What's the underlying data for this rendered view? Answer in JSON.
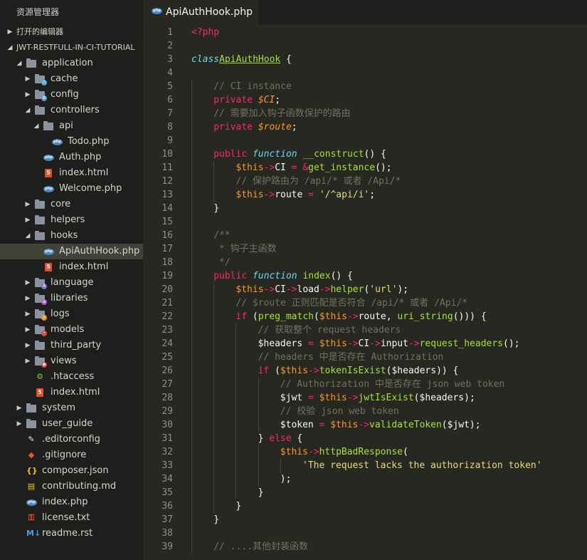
{
  "explorer": {
    "title": "资源管理器",
    "open_editors_label": "打开的编辑器",
    "project_label": "JWT-RESTFULL-IN-CI-TUTORIAL",
    "tree": [
      {
        "label": "application",
        "type": "folder",
        "icon": "folder-icon",
        "indent": 0,
        "chevron": "expanded"
      },
      {
        "label": "cache",
        "type": "folder",
        "icon": "folder-cache-icon",
        "indent": 1,
        "chevron": "collapsed"
      },
      {
        "label": "config",
        "type": "folder",
        "icon": "folder-config-icon",
        "indent": 1,
        "chevron": "collapsed"
      },
      {
        "label": "controllers",
        "type": "folder",
        "icon": "folder-icon",
        "indent": 1,
        "chevron": "expanded"
      },
      {
        "label": "api",
        "type": "folder",
        "icon": "folder-icon",
        "indent": 2,
        "chevron": "expanded"
      },
      {
        "label": "Todo.php",
        "type": "file",
        "icon": "php-icon",
        "indent": 3
      },
      {
        "label": "Auth.php",
        "type": "file",
        "icon": "php-icon",
        "indent": 2
      },
      {
        "label": "index.html",
        "type": "file",
        "icon": "html5-icon",
        "indent": 2
      },
      {
        "label": "Welcome.php",
        "type": "file",
        "icon": "php-icon",
        "indent": 2
      },
      {
        "label": "core",
        "type": "folder",
        "icon": "folder-icon",
        "indent": 1,
        "chevron": "collapsed"
      },
      {
        "label": "helpers",
        "type": "folder",
        "icon": "folder-icon",
        "indent": 1,
        "chevron": "collapsed"
      },
      {
        "label": "hooks",
        "type": "folder",
        "icon": "folder-icon",
        "indent": 1,
        "chevron": "expanded"
      },
      {
        "label": "ApiAuthHook.php",
        "type": "file",
        "icon": "php-icon",
        "indent": 2,
        "selected": true
      },
      {
        "label": "index.html",
        "type": "file",
        "icon": "html5-icon",
        "indent": 2
      },
      {
        "label": "language",
        "type": "folder",
        "icon": "folder-language-icon",
        "indent": 1,
        "chevron": "collapsed"
      },
      {
        "label": "libraries",
        "type": "folder",
        "icon": "folder-libraries-icon",
        "indent": 1,
        "chevron": "collapsed"
      },
      {
        "label": "logs",
        "type": "folder",
        "icon": "folder-logs-icon",
        "indent": 1,
        "chevron": "collapsed"
      },
      {
        "label": "models",
        "type": "folder",
        "icon": "folder-models-icon",
        "indent": 1,
        "chevron": "collapsed"
      },
      {
        "label": "third_party",
        "type": "folder",
        "icon": "folder-icon",
        "indent": 1,
        "chevron": "collapsed"
      },
      {
        "label": "views",
        "type": "folder",
        "icon": "folder-views-icon",
        "indent": 1,
        "chevron": "collapsed"
      },
      {
        "label": ".htaccess",
        "type": "file",
        "icon": "htaccess-icon",
        "indent": 1
      },
      {
        "label": "index.html",
        "type": "file",
        "icon": "html5-icon",
        "indent": 1
      },
      {
        "label": "system",
        "type": "folder",
        "icon": "folder-icon",
        "indent": 0,
        "chevron": "collapsed"
      },
      {
        "label": "user_guide",
        "type": "folder",
        "icon": "folder-icon",
        "indent": 0,
        "chevron": "collapsed"
      },
      {
        "label": ".editorconfig",
        "type": "file",
        "icon": "editorconfig-icon",
        "indent": 0
      },
      {
        "label": ".gitignore",
        "type": "file",
        "icon": "git-icon",
        "indent": 0
      },
      {
        "label": "composer.json",
        "type": "file",
        "icon": "json-icon",
        "indent": 0
      },
      {
        "label": "contributing.md",
        "type": "file",
        "icon": "markdown-icon",
        "indent": 0
      },
      {
        "label": "index.php",
        "type": "file",
        "icon": "php-icon",
        "indent": 0
      },
      {
        "label": "license.txt",
        "type": "file",
        "icon": "license-icon",
        "indent": 0
      },
      {
        "label": "readme.rst",
        "type": "file",
        "icon": "rst-icon",
        "indent": 0
      }
    ]
  },
  "tab": {
    "label": "ApiAuthHook.php",
    "icon": "php-icon"
  },
  "code": {
    "lines": [
      {
        "n": "1",
        "indent": 0,
        "tokens": [
          [
            "kw",
            "<?php"
          ]
        ]
      },
      {
        "n": "2",
        "indent": 0,
        "tokens": []
      },
      {
        "n": "3",
        "indent": 0,
        "tokens": [
          [
            "st",
            "class"
          ],
          [
            "",
            ""
          ],
          [
            " ",
            ""
          ],
          [
            "cls",
            "ApiAuthHook"
          ],
          [
            "",
            " {"
          ]
        ]
      },
      {
        "n": "4",
        "indent": 0,
        "tokens": []
      },
      {
        "n": "5",
        "indent": 1,
        "tokens": [
          [
            "cm",
            "// CI instance"
          ]
        ]
      },
      {
        "n": "6",
        "indent": 1,
        "tokens": [
          [
            "kw",
            "private"
          ],
          [
            "",
            " "
          ],
          [
            "var",
            "$CI"
          ],
          [
            "",
            ";"
          ]
        ]
      },
      {
        "n": "7",
        "indent": 1,
        "tokens": [
          [
            "cm",
            "// 需要加入钩子函数保护的路由"
          ]
        ]
      },
      {
        "n": "8",
        "indent": 1,
        "tokens": [
          [
            "kw",
            "private"
          ],
          [
            "",
            " "
          ],
          [
            "var",
            "$route"
          ],
          [
            "",
            ";"
          ]
        ]
      },
      {
        "n": "9",
        "indent": 1,
        "tokens": []
      },
      {
        "n": "10",
        "indent": 1,
        "tokens": [
          [
            "kw",
            "public"
          ],
          [
            "",
            " "
          ],
          [
            "st",
            "function"
          ],
          [
            "",
            " "
          ],
          [
            "fn",
            "__construct"
          ],
          [
            "",
            "() {"
          ]
        ]
      },
      {
        "n": "11",
        "indent": 2,
        "tokens": [
          [
            "th",
            "$this"
          ],
          [
            "kw",
            "->"
          ],
          [
            "",
            "CI "
          ],
          [
            "kw",
            "="
          ],
          [
            "",
            " "
          ],
          [
            "kw",
            "&"
          ],
          [
            "fn",
            "get_instance"
          ],
          [
            "",
            "();"
          ]
        ]
      },
      {
        "n": "12",
        "indent": 2,
        "tokens": [
          [
            "cm",
            "// 保护路由为 /api/* 或者 /Api/*"
          ]
        ]
      },
      {
        "n": "13",
        "indent": 2,
        "tokens": [
          [
            "th",
            "$this"
          ],
          [
            "kw",
            "->"
          ],
          [
            "",
            "route "
          ],
          [
            "kw",
            "="
          ],
          [
            "",
            " "
          ],
          [
            "str",
            "'/^api/i'"
          ],
          [
            "",
            ";"
          ]
        ]
      },
      {
        "n": "14",
        "indent": 1,
        "tokens": [
          [
            "",
            "}"
          ]
        ]
      },
      {
        "n": "15",
        "indent": 1,
        "tokens": []
      },
      {
        "n": "16",
        "indent": 1,
        "tokens": [
          [
            "cm",
            "/**"
          ]
        ]
      },
      {
        "n": "17",
        "indent": 1,
        "tokens": [
          [
            "cm",
            " * 钩子主函数"
          ]
        ]
      },
      {
        "n": "18",
        "indent": 1,
        "tokens": [
          [
            "cm",
            " */"
          ]
        ]
      },
      {
        "n": "19",
        "indent": 1,
        "tokens": [
          [
            "kw",
            "public"
          ],
          [
            "",
            " "
          ],
          [
            "st",
            "function"
          ],
          [
            "",
            " "
          ],
          [
            "fn",
            "index"
          ],
          [
            "",
            "() {"
          ]
        ]
      },
      {
        "n": "20",
        "indent": 2,
        "tokens": [
          [
            "th",
            "$this"
          ],
          [
            "kw",
            "->"
          ],
          [
            "",
            "CI"
          ],
          [
            "kw",
            "->"
          ],
          [
            "",
            "load"
          ],
          [
            "kw",
            "->"
          ],
          [
            "fn",
            "helper"
          ],
          [
            "",
            "("
          ],
          [
            "str",
            "'url'"
          ],
          [
            "",
            ");"
          ]
        ]
      },
      {
        "n": "21",
        "indent": 2,
        "tokens": [
          [
            "cm",
            "// $route 正则匹配是否符合 /api/* 或者 /Api/*"
          ]
        ]
      },
      {
        "n": "22",
        "indent": 2,
        "tokens": [
          [
            "kw",
            "if"
          ],
          [
            "",
            " ("
          ],
          [
            "fn",
            "preg_match"
          ],
          [
            "",
            "("
          ],
          [
            "th",
            "$this"
          ],
          [
            "kw",
            "->"
          ],
          [
            "",
            "route, "
          ],
          [
            "fn",
            "uri_string"
          ],
          [
            "",
            "())) {"
          ]
        ]
      },
      {
        "n": "23",
        "indent": 3,
        "tokens": [
          [
            "cm",
            "// 获取整个 request headers"
          ]
        ]
      },
      {
        "n": "24",
        "indent": 3,
        "tokens": [
          [
            "",
            "$headers "
          ],
          [
            "kw",
            "="
          ],
          [
            "",
            " "
          ],
          [
            "th",
            "$this"
          ],
          [
            "kw",
            "->"
          ],
          [
            "",
            "CI"
          ],
          [
            "kw",
            "->"
          ],
          [
            "",
            "input"
          ],
          [
            "kw",
            "->"
          ],
          [
            "fn",
            "request_headers"
          ],
          [
            "",
            "();"
          ]
        ]
      },
      {
        "n": "25",
        "indent": 3,
        "tokens": [
          [
            "cm",
            "// headers 中是否存在 Authorization"
          ]
        ]
      },
      {
        "n": "26",
        "indent": 3,
        "tokens": [
          [
            "kw",
            "if"
          ],
          [
            "",
            " ("
          ],
          [
            "th",
            "$this"
          ],
          [
            "kw",
            "->"
          ],
          [
            "fn",
            "tokenIsExist"
          ],
          [
            "",
            "($headers)) {"
          ]
        ]
      },
      {
        "n": "27",
        "indent": 4,
        "tokens": [
          [
            "cm",
            "// Authorization 中是否存在 json web token"
          ]
        ]
      },
      {
        "n": "28",
        "indent": 4,
        "tokens": [
          [
            "",
            "$jwt "
          ],
          [
            "kw",
            "="
          ],
          [
            "",
            " "
          ],
          [
            "th",
            "$this"
          ],
          [
            "kw",
            "->"
          ],
          [
            "fn",
            "jwtIsExist"
          ],
          [
            "",
            "($headers);"
          ]
        ]
      },
      {
        "n": "29",
        "indent": 4,
        "tokens": [
          [
            "cm",
            "// 校验 json web token"
          ]
        ]
      },
      {
        "n": "30",
        "indent": 4,
        "tokens": [
          [
            "",
            "$token "
          ],
          [
            "kw",
            "="
          ],
          [
            "",
            " "
          ],
          [
            "th",
            "$this"
          ],
          [
            "kw",
            "->"
          ],
          [
            "fn",
            "validateToken"
          ],
          [
            "",
            "($jwt);"
          ]
        ]
      },
      {
        "n": "31",
        "indent": 3,
        "tokens": [
          [
            "",
            "} "
          ],
          [
            "kw",
            "else"
          ],
          [
            "",
            " {"
          ]
        ]
      },
      {
        "n": "32",
        "indent": 4,
        "tokens": [
          [
            "th",
            "$this"
          ],
          [
            "kw",
            "->"
          ],
          [
            "fn",
            "httpBadResponse"
          ],
          [
            "",
            "("
          ]
        ]
      },
      {
        "n": "33",
        "indent": 5,
        "tokens": [
          [
            "str",
            "'The request lacks the authorization token'"
          ]
        ]
      },
      {
        "n": "34",
        "indent": 4,
        "tokens": [
          [
            "",
            ");"
          ]
        ]
      },
      {
        "n": "35",
        "indent": 3,
        "tokens": [
          [
            "",
            "}"
          ]
        ]
      },
      {
        "n": "36",
        "indent": 2,
        "tokens": [
          [
            "",
            "}"
          ]
        ]
      },
      {
        "n": "37",
        "indent": 1,
        "tokens": [
          [
            "",
            "}"
          ]
        ]
      },
      {
        "n": "38",
        "indent": 1,
        "tokens": []
      },
      {
        "n": "39",
        "indent": 1,
        "tokens": [
          [
            "cm",
            "// ....其他封装函数"
          ]
        ]
      }
    ]
  },
  "colors": {
    "editor_bg": "#272822",
    "sidebar_bg": "#1e1f1c",
    "selection": "#414339",
    "keyword": "#f92672",
    "function": "#a6e22e",
    "string": "#e6db74",
    "comment": "#75715e",
    "storage": "#66d9ef",
    "variable": "#fd971f"
  }
}
